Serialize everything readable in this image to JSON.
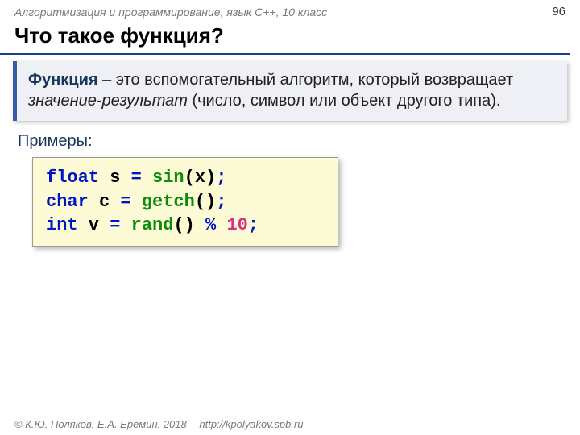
{
  "header": {
    "course": "Алгоритмизация и программирование, язык  C++, 10 класс",
    "page": "96"
  },
  "title": "Что такое функция?",
  "definition": {
    "term": "Функция",
    "dash": " – ",
    "body1": "это вспомогательный алгоритм, который возвращает ",
    "italic": "значение-результат",
    "body2": " (число, символ или объект другого типа)."
  },
  "examples_label": "Примеры:",
  "code": {
    "l1": {
      "t1": "float",
      "t2": " s ",
      "t3": "=",
      "t4": " ",
      "t5": "sin",
      "t6": "(x)",
      "t7": ";"
    },
    "l2": {
      "t1": "char",
      "t2": " c ",
      "t3": "=",
      "t4": " ",
      "t5": "getch",
      "t6": "()",
      "t7": ";"
    },
    "l3": {
      "t1": "int",
      "t2": " v ",
      "t3": "=",
      "t4": " ",
      "t5": "rand",
      "t6": "()",
      "t7": " % ",
      "t8": "10",
      "t9": ";"
    }
  },
  "footer": {
    "copyright": "© К.Ю. Поляков, Е.А. Ерёмин, 2018",
    "url": "http://kpolyakov.spb.ru"
  }
}
